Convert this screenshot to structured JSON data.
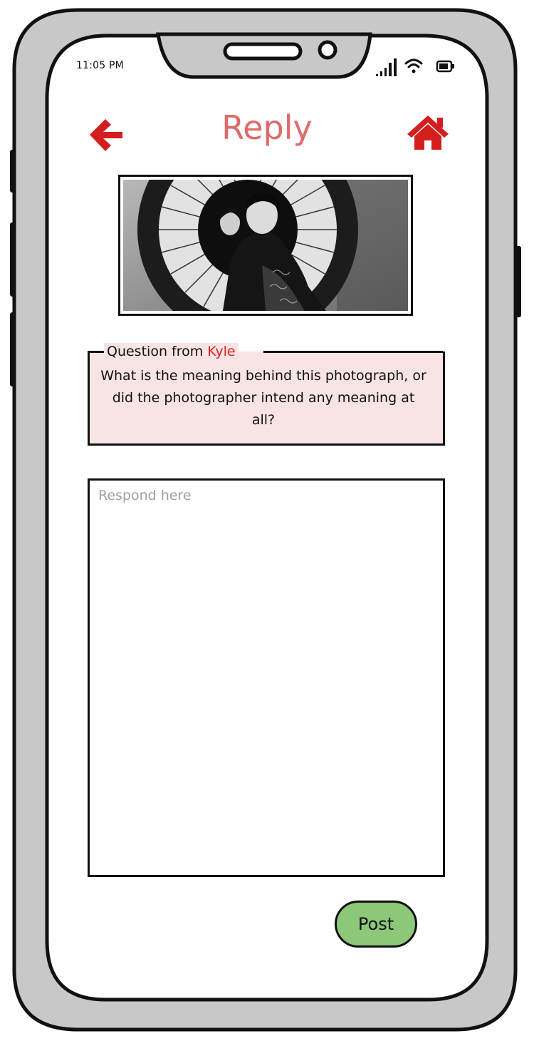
{
  "status_bar": {
    "time": "11:05 PM",
    "icons": [
      "signal-icon",
      "wifi-icon",
      "battery-icon"
    ]
  },
  "header": {
    "title": "Reply",
    "back_icon": "arrow-left-icon",
    "home_icon": "home-icon"
  },
  "question": {
    "prefix": "Question from",
    "asker": "Kyle",
    "text": "What is the meaning behind this photograph, or did the photographer intend any meaning at all?"
  },
  "response": {
    "placeholder": "Respond here",
    "value": ""
  },
  "actions": {
    "post_label": "Post"
  },
  "colors": {
    "accent_red": "#d41e1e",
    "title_red": "#e06a6a",
    "question_bg": "#f8e4e4",
    "post_green": "#8cc878",
    "frame_gray": "#c8c8c8"
  }
}
